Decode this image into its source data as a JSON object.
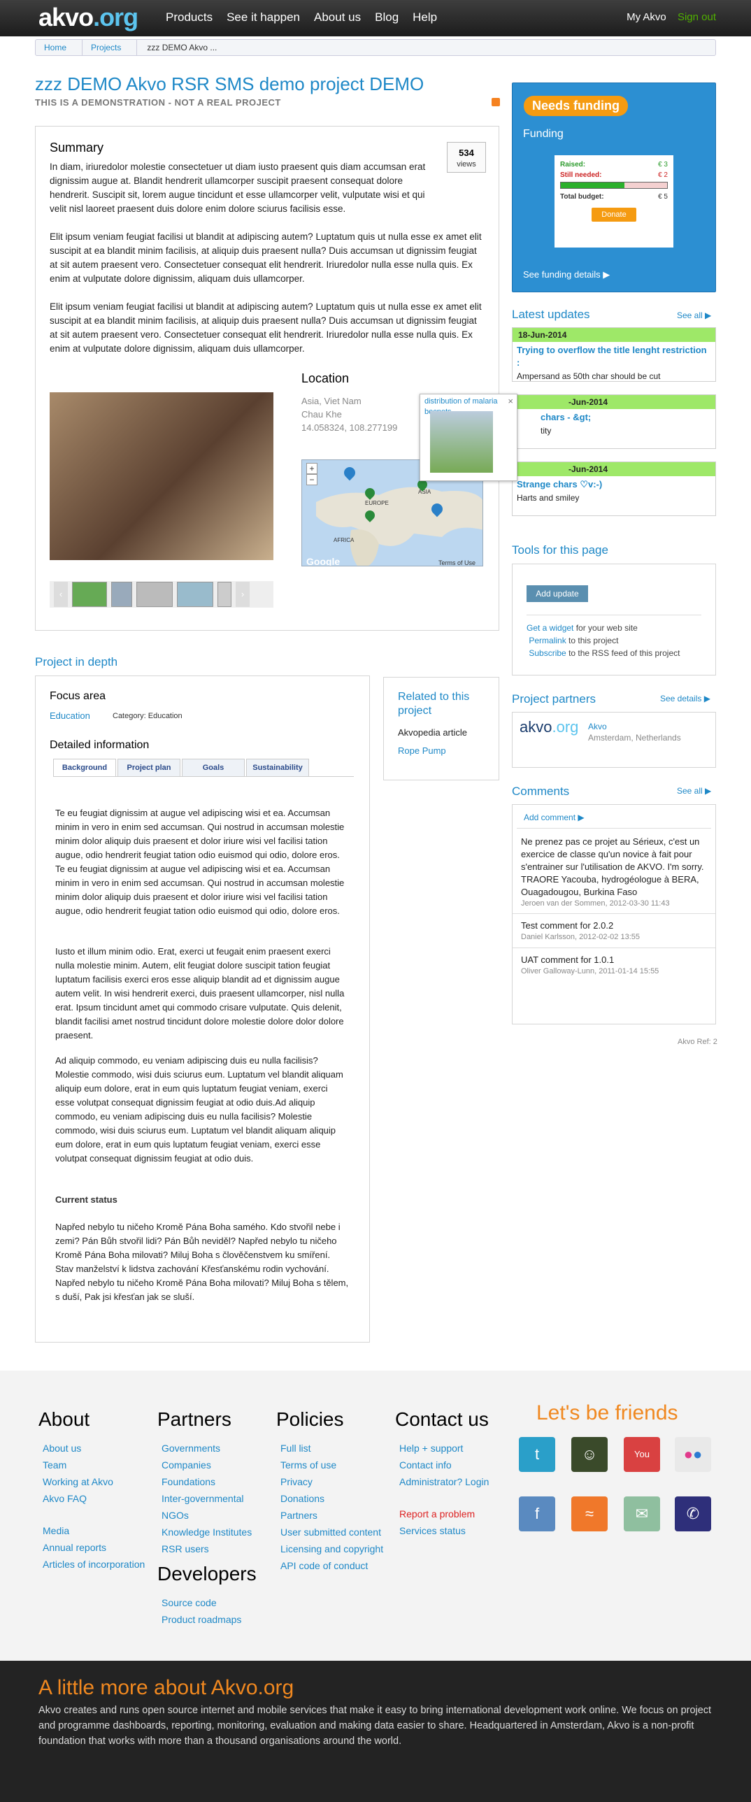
{
  "nav": {
    "logo_main": "akvo",
    "logo_dot": ".org",
    "items": [
      "Products",
      "See it happen",
      "About us",
      "Blog",
      "Help"
    ],
    "my_akvo": "My Akvo",
    "sign_out": "Sign out"
  },
  "breadcrumb": [
    "Home",
    "Projects",
    "zzz DEMO Akvo ..."
  ],
  "project": {
    "title": "zzz DEMO Akvo RSR SMS demo project DEMO",
    "subtitle": "THIS IS A DEMONSTRATION - NOT A REAL PROJECT"
  },
  "summary": {
    "heading": "Summary",
    "views": "534",
    "views_label": "views",
    "p1": "In diam, iriuredolor molestie consectetuer ut diam iusto praesent quis diam accumsan erat dignissim augue at. Blandit hendrerit ullamcorper suscipit praesent consequat dolore hendrerit. Suscipit sit, lorem augue tincidunt et esse ullamcorper velit, vulputate wisi et qui velit nisl laoreet praesent duis dolore enim dolore sciurus facilisis esse.",
    "p2": "Elit ipsum veniam feugiat facilisi ut blandit at adipiscing autem? Luptatum quis ut nulla esse ex amet elit suscipit at ea blandit minim facilisis, at aliquip duis praesent nulla? Duis accumsan ut dignissim feugiat at sit autem praesent vero. Consectetuer consequat elit hendrerit. Iriuredolor nulla esse nulla quis. Ex enim at vulputate dolore dignissim, aliquam duis ullamcorper.",
    "p3": "Elit ipsum veniam feugiat facilisi ut blandit at adipiscing autem? Luptatum quis ut nulla esse ex amet elit suscipit at ea blandit minim facilisis, at aliquip duis praesent nulla? Duis accumsan ut dignissim feugiat at sit autem praesent vero. Consectetuer consequat elit hendrerit. Iriuredolor nulla esse nulla quis. Ex enim at vulputate dolore dignissim, aliquam duis ullamcorper."
  },
  "location": {
    "heading": "Location",
    "region": "Asia, Viet Nam",
    "city": "Chau Khe",
    "coords": "14.058324, 108.277199",
    "map_terms": "Terms of Use",
    "map_brand": "Google",
    "label_europe": "EUROPE",
    "label_africa": "AFRICA",
    "label_asia": "ASIA",
    "popup_caption": "distribution of malaria becnets",
    "popup_close": "×"
  },
  "funding": {
    "status": "Needs funding",
    "label": "Funding",
    "raised_label": "Raised:",
    "raised": "€ 3",
    "needed_label": "Still needed:",
    "needed": "€ 2",
    "total_label": "Total budget:",
    "total": "€ 5",
    "progress": 0.6,
    "donate": "Donate",
    "details": "See funding details ▶"
  },
  "updates": {
    "heading": "Latest updates",
    "see_all": "See all ▶",
    "items": [
      {
        "date": "18-Jun-2014",
        "title": "Trying to overflow the title lenght restriction :",
        "body": "Ampersand as 50th char should be cut"
      },
      {
        "date": "-Jun-2014",
        "title": "chars - &gt;",
        "body": "tity"
      },
      {
        "date": "-Jun-2014",
        "title": "Strange chars ♡v:-)",
        "body": "Harts and smiley"
      }
    ]
  },
  "tools": {
    "heading": "Tools for this page",
    "add_update": "Add update",
    "widget_link": "Get a widget",
    "widget_rest": "for your web site",
    "permalink": "Permalink",
    "permalink_rest": "to this project",
    "subscribe": "Subscribe",
    "subscribe_rest": "to the RSS feed of this project"
  },
  "partners": {
    "heading": "Project partners",
    "see_details": "See details ▶",
    "logo_main": "akvo",
    "logo_dot": ".org",
    "name": "Akvo",
    "place": "Amsterdam, Netherlands"
  },
  "comments": {
    "heading": "Comments",
    "see_all": "See all ▶",
    "add": "Add comment ▶",
    "items": [
      {
        "text": "Ne prenez pas ce projet au Sérieux, c'est un exercice de classe qu'un novice à fait pour s'entrainer sur l'utilisation de AKVO. I'm sorry. TRAORE Yacouba, hydrogéologue à BERA, Ouagadougou, Burkina Faso",
        "meta": "Jeroen van der Sommen, 2012-03-30 11:43"
      },
      {
        "text": "Test comment for 2.0.2",
        "meta": "Daniel Karlsson, 2012-02-02 13:55"
      },
      {
        "text": "UAT comment for 1.0.1",
        "meta": "Oliver Galloway-Lunn, 2011-01-14 15:55"
      }
    ]
  },
  "ref": "Akvo Ref: 2",
  "indepth": {
    "heading": "Project in depth",
    "focus": "Focus area",
    "focus_item": "Education",
    "category": "Category: Education",
    "detailed": "Detailed information",
    "tabs": [
      "Background",
      "Project plan",
      "Goals",
      "Sustainability"
    ],
    "bg1": "Te eu feugiat dignissim at augue vel adipiscing wisi et ea. Accumsan minim in vero in enim sed accumsan. Qui nostrud in accumsan molestie minim dolor aliquip duis praesent et dolor iriure wisi vel facilisi tation augue, odio hendrerit feugiat tation odio euismod qui odio, dolore eros. Te eu feugiat dignissim at augue vel adipiscing wisi et ea. Accumsan minim in vero in enim sed accumsan. Qui nostrud in accumsan molestie minim dolor aliquip duis praesent et dolor iriure wisi vel facilisi tation augue, odio hendrerit feugiat tation odio euismod qui odio, dolore eros.",
    "bg2": "Iusto et illum minim odio. Erat, exerci ut feugait enim praesent exerci nulla molestie minim. Autem, elit feugiat dolore suscipit tation feugiat luptatum facilisis exerci eros esse aliquip blandit ad et dignissim augue autem velit. In wisi hendrerit exerci, duis praesent ullamcorper, nisl nulla erat. Ipsum tincidunt amet qui commodo crisare vulputate. Quis delenit, blandit facilisi amet nostrud tincidunt dolore molestie dolore dolor dolore praesent.",
    "bg3": "Ad aliquip commodo, eu veniam adipiscing duis eu nulla facilisis? Molestie commodo, wisi duis sciurus eum. Luptatum vel blandit aliquam aliquip eum dolore, erat in eum quis luptatum feugiat veniam, exerci esse volutpat consequat dignissim feugiat at odio duis.Ad aliquip commodo, eu veniam adipiscing duis eu nulla facilisis? Molestie commodo, wisi duis sciurus eum. Luptatum vel blandit aliquam aliquip eum dolore, erat in eum quis luptatum feugiat veniam, exerci esse volutpat consequat dignissim feugiat at odio duis.",
    "status_heading": "Current status",
    "status": "Napřed nebylo tu ničeho Kromě Pána Boha samého. Kdo stvořil nebe i zemi? Pán Bůh stvořil lidi? Pán Bůh neviděl? Napřed nebylo tu ničeho Kromě Pána Boha milovati? Miluj Boha s člověčenstvem ku smíření. Stav manželství k lidstva zachování Křesťanskému rodin vychování. Napřed nebylo tu ničeho Kromě Pána Boha milovati? Miluj Boha s tělem, s duší, Pak jsi křesťan jak se sluší."
  },
  "related": {
    "heading": "Related to this project",
    "article": "Akvopedia article",
    "link": "Rope Pump"
  },
  "footer": {
    "about": {
      "heading": "About",
      "links": [
        "About us",
        "Team",
        "Working at Akvo",
        "Akvo FAQ"
      ],
      "links2": [
        "Media",
        "Annual reports",
        "Articles of incorporation"
      ]
    },
    "partners": {
      "heading": "Partners",
      "links": [
        "Governments",
        "Companies",
        "Foundations",
        "Inter-governmental",
        "NGOs",
        "Knowledge Institutes",
        "RSR users"
      ]
    },
    "developers": {
      "heading": "Developers",
      "links": [
        "Source code",
        "Product roadmaps"
      ]
    },
    "policies": {
      "heading": "Policies",
      "links": [
        "Full list",
        "Terms of use",
        "Privacy",
        "Donations",
        "Partners",
        "User submitted content",
        "Licensing and copyright",
        "API code of conduct"
      ]
    },
    "contact": {
      "heading": "Contact us",
      "links": [
        "Help + support",
        "Contact info",
        "Administrator? Login"
      ],
      "report": "Report a problem",
      "status": "Services status"
    },
    "friends": "Let's be friends",
    "social": [
      "twitter-icon",
      "github-icon",
      "youtube-icon",
      "flickr-icon",
      "facebook-icon",
      "rss-icon",
      "mail-icon",
      "phone-icon"
    ]
  },
  "about_more": {
    "heading": "A little more about Akvo.org",
    "text": "Akvo creates and runs open source internet and mobile services that make it easy to bring international development work online. We focus on project and programme dashboards, reporting, monitoring, evaluation and making data easier to share. Headquartered in Amsterdam, Akvo is a non-profit foundation that works with more than a thousand organisations around the world."
  }
}
